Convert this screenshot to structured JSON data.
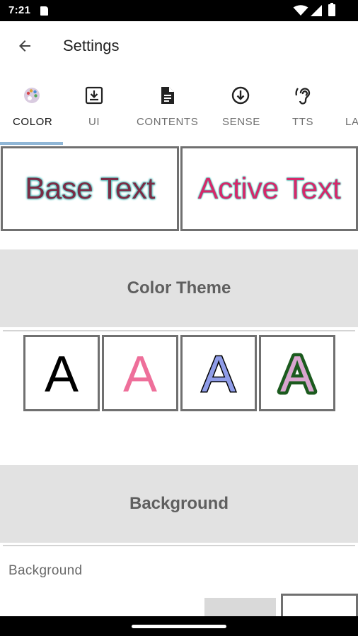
{
  "status_bar": {
    "time": "7:21",
    "icons": [
      "sd-card-icon",
      "wifi-icon",
      "cellular-signal-icon",
      "battery-icon"
    ]
  },
  "app_bar": {
    "back_icon": "arrow-back-icon",
    "title": "Settings"
  },
  "tabs": [
    {
      "label": "COLOR",
      "icon": "palette-icon",
      "active": true
    },
    {
      "label": "UI",
      "icon": "download-box-icon",
      "active": false
    },
    {
      "label": "CONTENTS",
      "icon": "document-icon",
      "active": false
    },
    {
      "label": "SENSE",
      "icon": "arrow-down-circle-icon",
      "active": false
    },
    {
      "label": "TTS",
      "icon": "hearing-icon",
      "active": false
    },
    {
      "label": "LA",
      "icon": "",
      "active": false
    }
  ],
  "preview": {
    "base_text": "Base Text",
    "active_text": "Active Text",
    "colors": {
      "base_fill": "#7a2c45",
      "base_outline": "#5ec4c0",
      "active_fill": "#d6286a",
      "active_outline": "#3fc5b6"
    }
  },
  "color_theme": {
    "header": "Color Theme",
    "swatches": [
      {
        "letter": "A",
        "fill": "#000000",
        "stroke": "none"
      },
      {
        "letter": "A",
        "fill": "#ee6f9a",
        "stroke": "none"
      },
      {
        "letter": "A",
        "fill": "#8f9ce8",
        "stroke": "#000000"
      },
      {
        "letter": "A",
        "fill": "#d9a5cf",
        "stroke": "#1b5a1e"
      }
    ]
  },
  "background": {
    "header": "Background",
    "label": "Background",
    "option_colors": [
      "#d9d9d9",
      "#ffffff"
    ]
  }
}
